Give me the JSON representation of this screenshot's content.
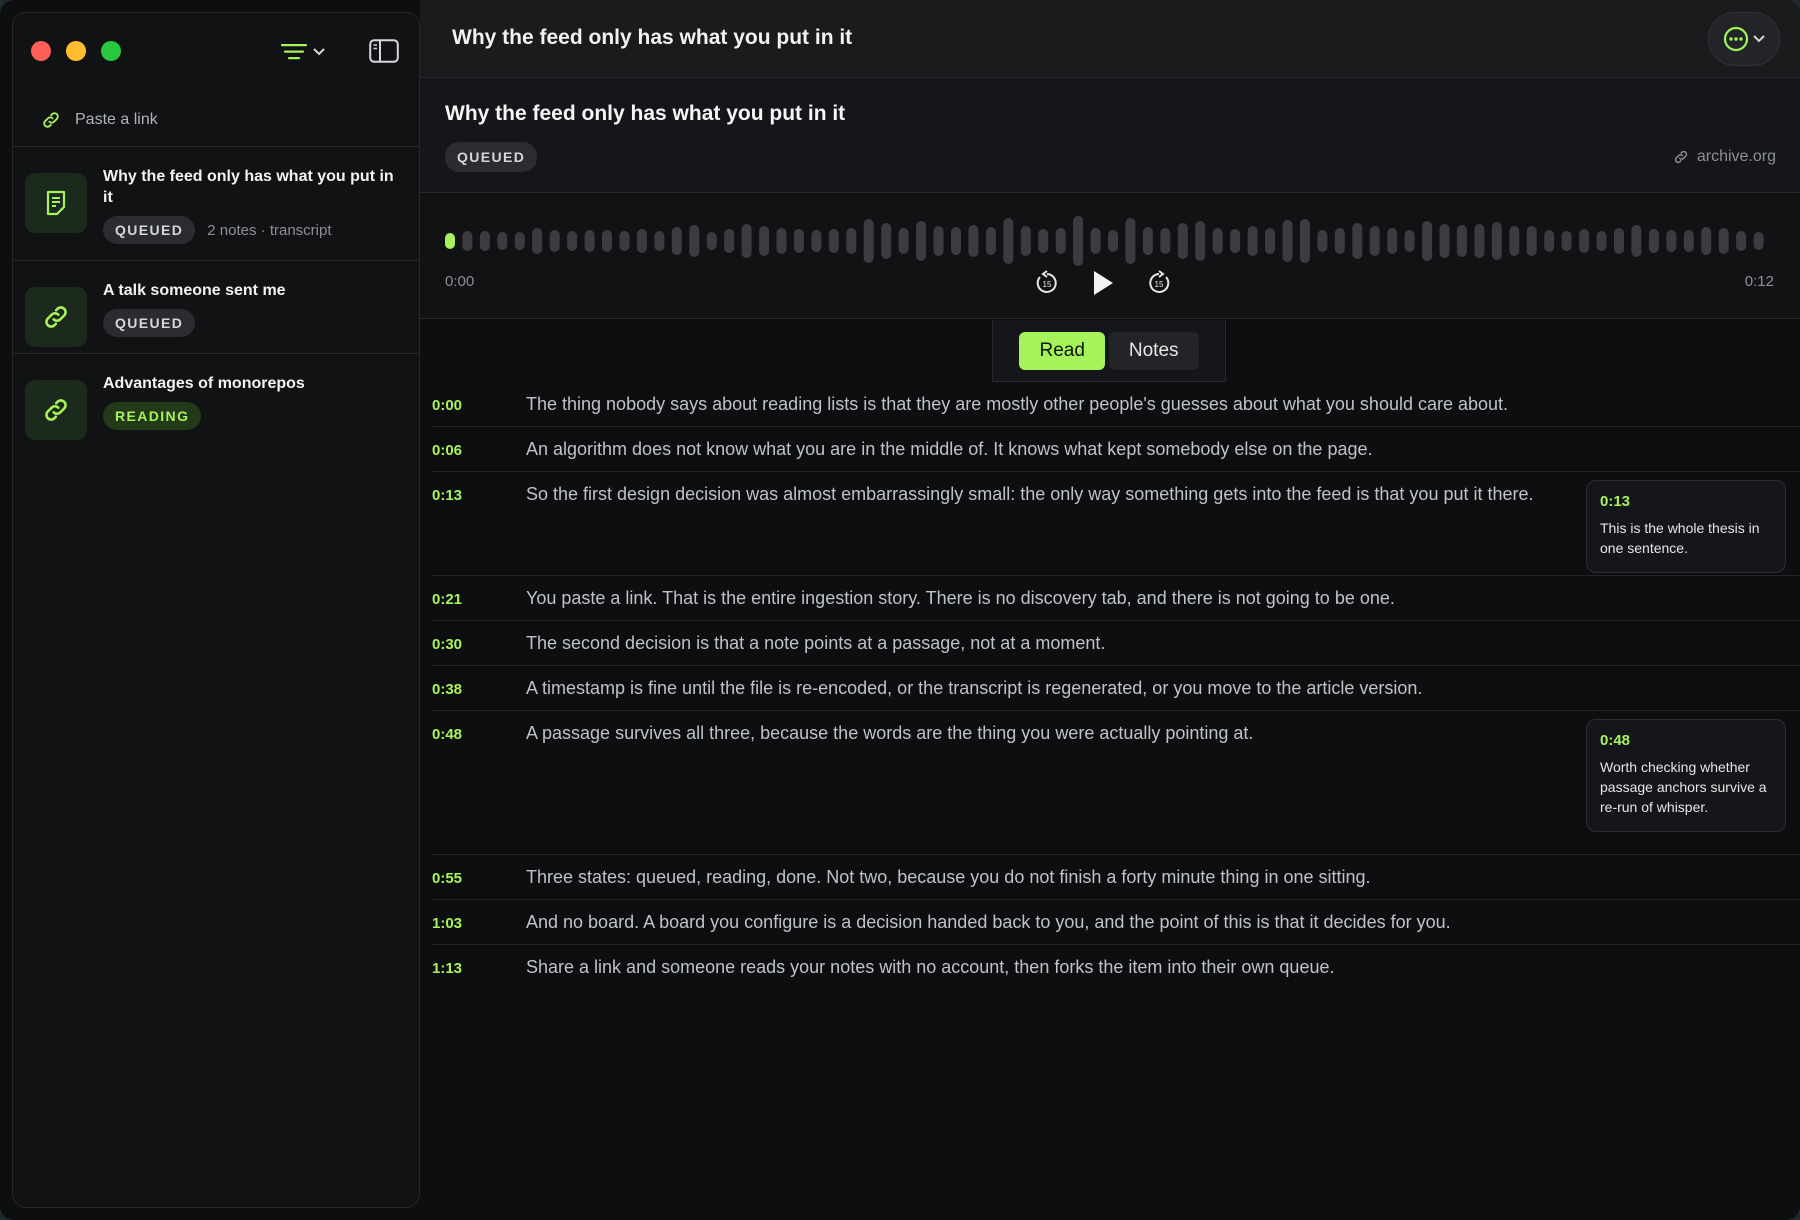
{
  "sidebar": {
    "paste_placeholder": "Paste a link",
    "items": [
      {
        "title": "Why the feed only has what you put in it",
        "status": "QUEUED",
        "meta": "2 notes · transcript",
        "icon": "document-icon"
      },
      {
        "title": "A talk someone sent me",
        "status": "QUEUED",
        "meta": "",
        "icon": "link-icon"
      },
      {
        "title": "Advantages of monorepos",
        "status": "READING",
        "meta": "",
        "icon": "link-icon"
      }
    ]
  },
  "window_title": "Why the feed only has what you put in it",
  "header": {
    "title": "Why the feed only has what you put in it",
    "status": "QUEUED",
    "source": "archive.org"
  },
  "player": {
    "time_start": "0:00",
    "time_end": "0:12",
    "skip_back": "15",
    "skip_forward": "15",
    "progress": 0.0
  },
  "tabs": {
    "read": "Read",
    "notes": "Notes",
    "active": "read"
  },
  "transcript": [
    {
      "ts": "0:00",
      "text": "The thing nobody says about reading lists is that they are mostly other people's guesses about what you should care about."
    },
    {
      "ts": "0:06",
      "text": "An algorithm does not know what you are in the middle of. It knows what kept somebody else on the page."
    },
    {
      "ts": "0:13",
      "text": "So the first design decision was almost embarrassingly small: the only way something gets into the feed is that you put it there.",
      "note": {
        "ts": "0:13",
        "text": "This is the whole thesis in one sentence."
      }
    },
    {
      "ts": "0:21",
      "text": "You paste a link. That is the entire ingestion story. There is no discovery tab, and there is not going to be one."
    },
    {
      "ts": "0:30",
      "text": "The second decision is that a note points at a passage, not at a moment."
    },
    {
      "ts": "0:38",
      "text": "A timestamp is fine until the file is re-encoded, or the transcript is regenerated, or you move to the article version."
    },
    {
      "ts": "0:48",
      "text": "A passage survives all three, because the words are the thing you were actually pointing at.",
      "note": {
        "ts": "0:48",
        "text": "Worth checking whether passage anchors survive a re-run of whisper."
      }
    },
    {
      "ts": "0:55",
      "text": "Three states: queued, reading, done. Not two, because you do not finish a forty minute thing in one sitting."
    },
    {
      "ts": "1:03",
      "text": "And no board. A board you configure is a decision handed back to you, and the point of this is that it decides for you."
    },
    {
      "ts": "1:13",
      "text": "Share a link and someone reads your notes with no account, then forks the item into their own queue."
    }
  ],
  "colors": {
    "accent": "#a6f25a",
    "background": "#0d0e10",
    "sidebar": "#111214"
  }
}
